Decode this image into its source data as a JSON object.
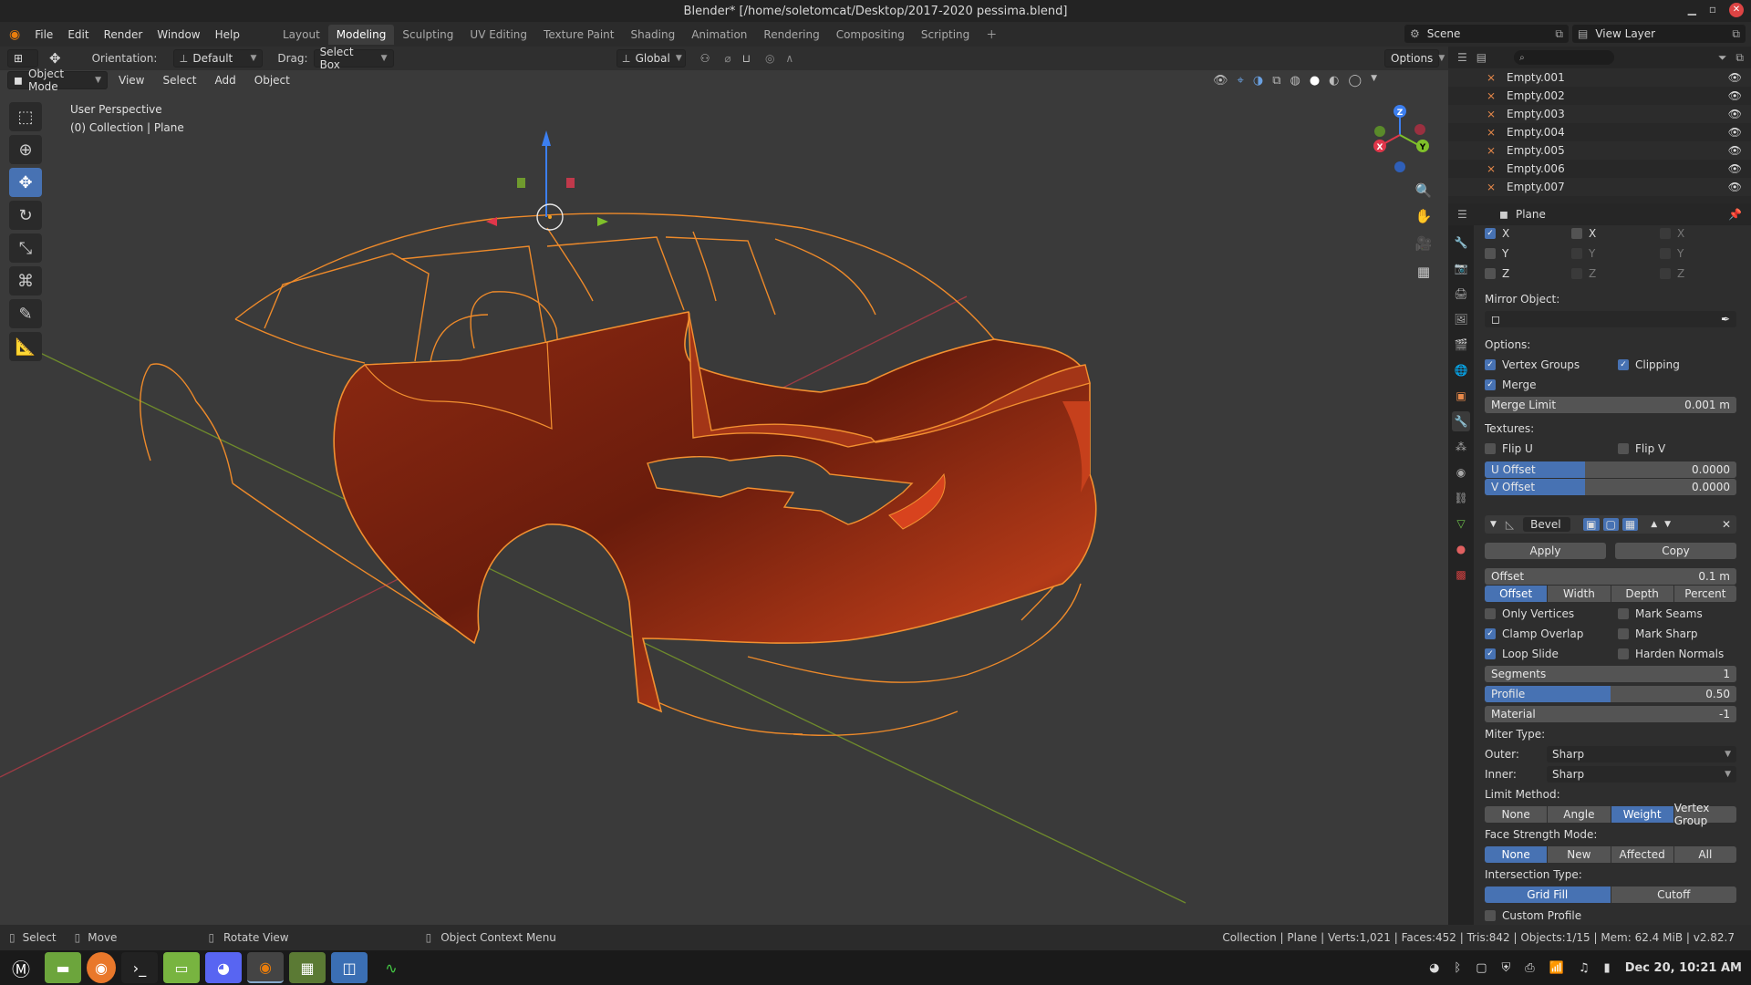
{
  "title": "Blender* [/home/soletomcat/Desktop/2017-2020 pessima.blend]",
  "menus": [
    "File",
    "Edit",
    "Render",
    "Window",
    "Help"
  ],
  "workspaces": [
    "Layout",
    "Modeling",
    "Sculpting",
    "UV Editing",
    "Texture Paint",
    "Shading",
    "Animation",
    "Rendering",
    "Compositing",
    "Scripting"
  ],
  "active_workspace": "Modeling",
  "scene": "Scene",
  "view_layer": "View Layer",
  "tool_header": {
    "orientation_label": "Orientation:",
    "orientation": "Default",
    "drag_label": "Drag:",
    "drag": "Select Box",
    "transform": "Global",
    "options": "Options"
  },
  "viewport_header": {
    "mode": "Object Mode",
    "items": [
      "View",
      "Select",
      "Add",
      "Object"
    ]
  },
  "viewport": {
    "perspective": "User Perspective",
    "collection": "(0) Collection | Plane"
  },
  "gizmo": {
    "x": "X",
    "y": "Y",
    "z": "Z"
  },
  "outliner": {
    "items": [
      "Empty.001",
      "Empty.002",
      "Empty.003",
      "Empty.004",
      "Empty.005",
      "Empty.006",
      "Empty.007"
    ]
  },
  "properties": {
    "object": "Plane",
    "axis": {
      "x": "X",
      "y": "Y",
      "z": "Z"
    },
    "mirror_object_label": "Mirror Object:",
    "options_label": "Options:",
    "vertex_groups": "Vertex Groups",
    "clipping": "Clipping",
    "merge": "Merge",
    "merge_limit_label": "Merge Limit",
    "merge_limit": "0.001 m",
    "textures_label": "Textures:",
    "flip_u": "Flip U",
    "flip_v": "Flip V",
    "u_offset_label": "U Offset",
    "u_offset": "0.0000",
    "v_offset_label": "V Offset",
    "v_offset": "0.0000",
    "modifier_name": "Bevel",
    "apply": "Apply",
    "copy": "Copy",
    "offset_label": "Offset",
    "offset": "0.1 m",
    "offset_types": [
      "Offset",
      "Width",
      "Depth",
      "Percent"
    ],
    "only_vertices": "Only Vertices",
    "mark_seams": "Mark Seams",
    "clamp_overlap": "Clamp Overlap",
    "mark_sharp": "Mark Sharp",
    "loop_slide": "Loop Slide",
    "harden_normals": "Harden Normals",
    "segments_label": "Segments",
    "segments": "1",
    "profile_label": "Profile",
    "profile": "0.50",
    "profile_fraction": 0.5,
    "material_label": "Material",
    "material": "-1",
    "miter_label": "Miter Type:",
    "outer_label": "Outer:",
    "outer": "Sharp",
    "inner_label": "Inner:",
    "inner": "Sharp",
    "limit_label": "Limit Method:",
    "limit_methods": [
      "None",
      "Angle",
      "Weight",
      "Vertex Group"
    ],
    "face_strength_label": "Face Strength Mode:",
    "face_strength": [
      "None",
      "New",
      "Affected",
      "All"
    ],
    "intersection_label": "Intersection Type:",
    "intersection": [
      "Grid Fill",
      "Cutoff"
    ],
    "custom_profile": "Custom Profile"
  },
  "statusbar": {
    "select": "Select",
    "move": "Move",
    "rotate": "Rotate View",
    "context": "Object Context Menu",
    "stats": "Collection | Plane | Verts:1,021 | Faces:452 | Tris:842 | Objects:1/15 | Mem: 62.4 MiB | v2.82.7"
  },
  "taskbar": {
    "clock": "Dec 20, 10:21 AM"
  }
}
